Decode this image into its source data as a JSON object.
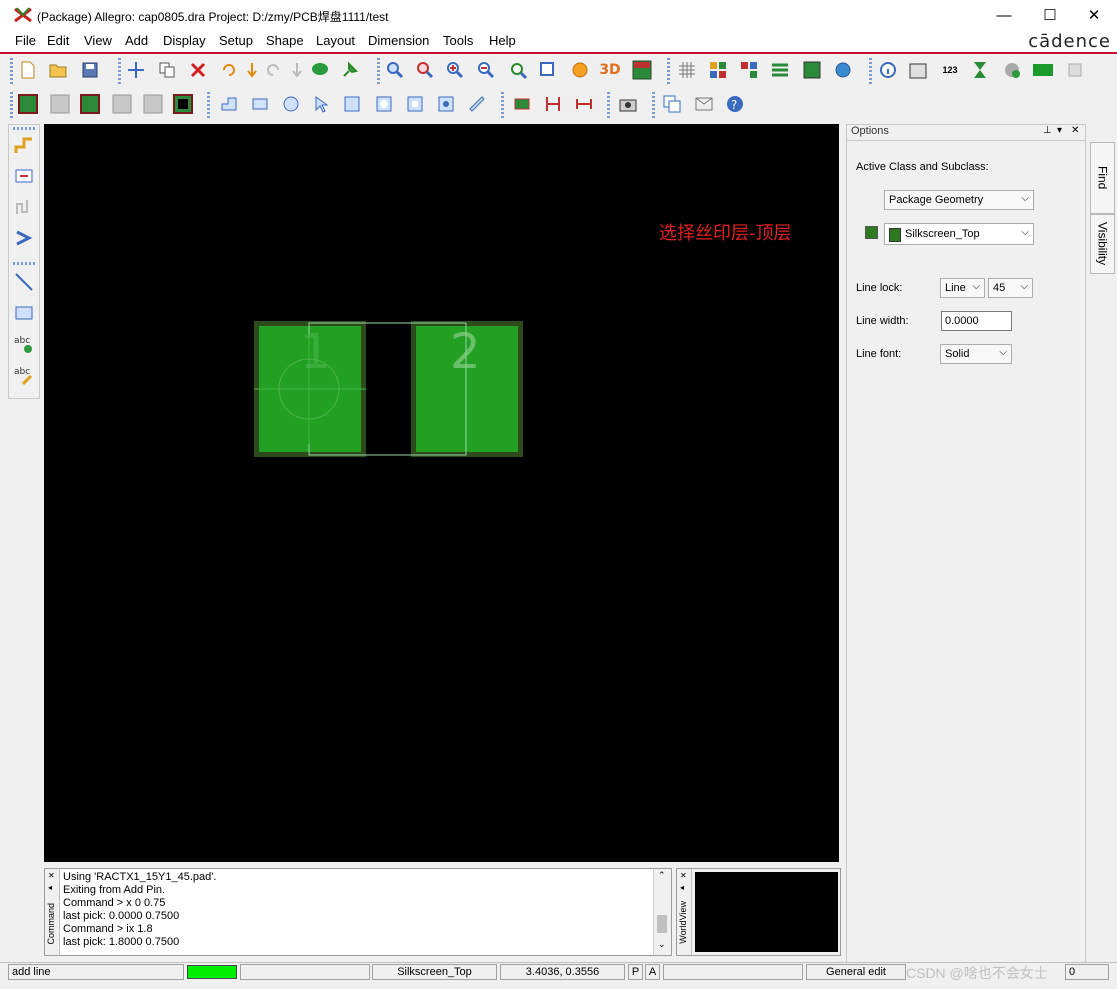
{
  "window": {
    "title": "(Package) Allegro: cap0805.dra  Project: D:/zmy/PCB焊盘1111/test",
    "controls": {
      "minimize": "—",
      "maximize": "☐",
      "close": "✕"
    }
  },
  "menu": {
    "items": [
      "File",
      "Edit",
      "View",
      "Add",
      "Display",
      "Setup",
      "Shape",
      "Layout",
      "Dimension",
      "Tools",
      "Help"
    ],
    "logo": "cādence"
  },
  "canvas": {
    "pin1_label": "1",
    "pin2_label": "2",
    "pad_color": "#22a022",
    "pad_border_color": "#2d4a1a"
  },
  "annotation": {
    "text": "选择丝印层-顶层",
    "color": "#e02020"
  },
  "options": {
    "header": "Options",
    "active_class_label": "Active Class and Subclass:",
    "class_value": "Package Geometry",
    "subclass_value": "Silkscreen_Top",
    "subclass_color": "#2e7a1e",
    "line_lock_label": "Line lock:",
    "line_lock_value": "Line",
    "line_lock_angle": "45",
    "line_width_label": "Line width:",
    "line_width_value": "0.0000",
    "line_font_label": "Line font:",
    "line_font_value": "Solid",
    "side_tabs": [
      "Find",
      "Visibility"
    ]
  },
  "command_window": {
    "label": "Command",
    "lines": [
      "Using 'RACTX1_15Y1_45.pad'.",
      "Exiting from Add Pin.",
      "Command > x 0 0.75",
      "last pick:  0.0000 0.7500",
      "Command > ix 1.8",
      "last pick:  1.8000 0.7500"
    ]
  },
  "world_view": {
    "label": "WorldView"
  },
  "status": {
    "command": "add line",
    "indicator_color": "#00ee00",
    "subclass": "Silkscreen_Top",
    "coords": "3.4036, 0.3556",
    "p_flag": "P",
    "a_flag": "A",
    "mode": "General edit",
    "watermark": "CSDN @啥也不会女士",
    "right_value": "0"
  }
}
